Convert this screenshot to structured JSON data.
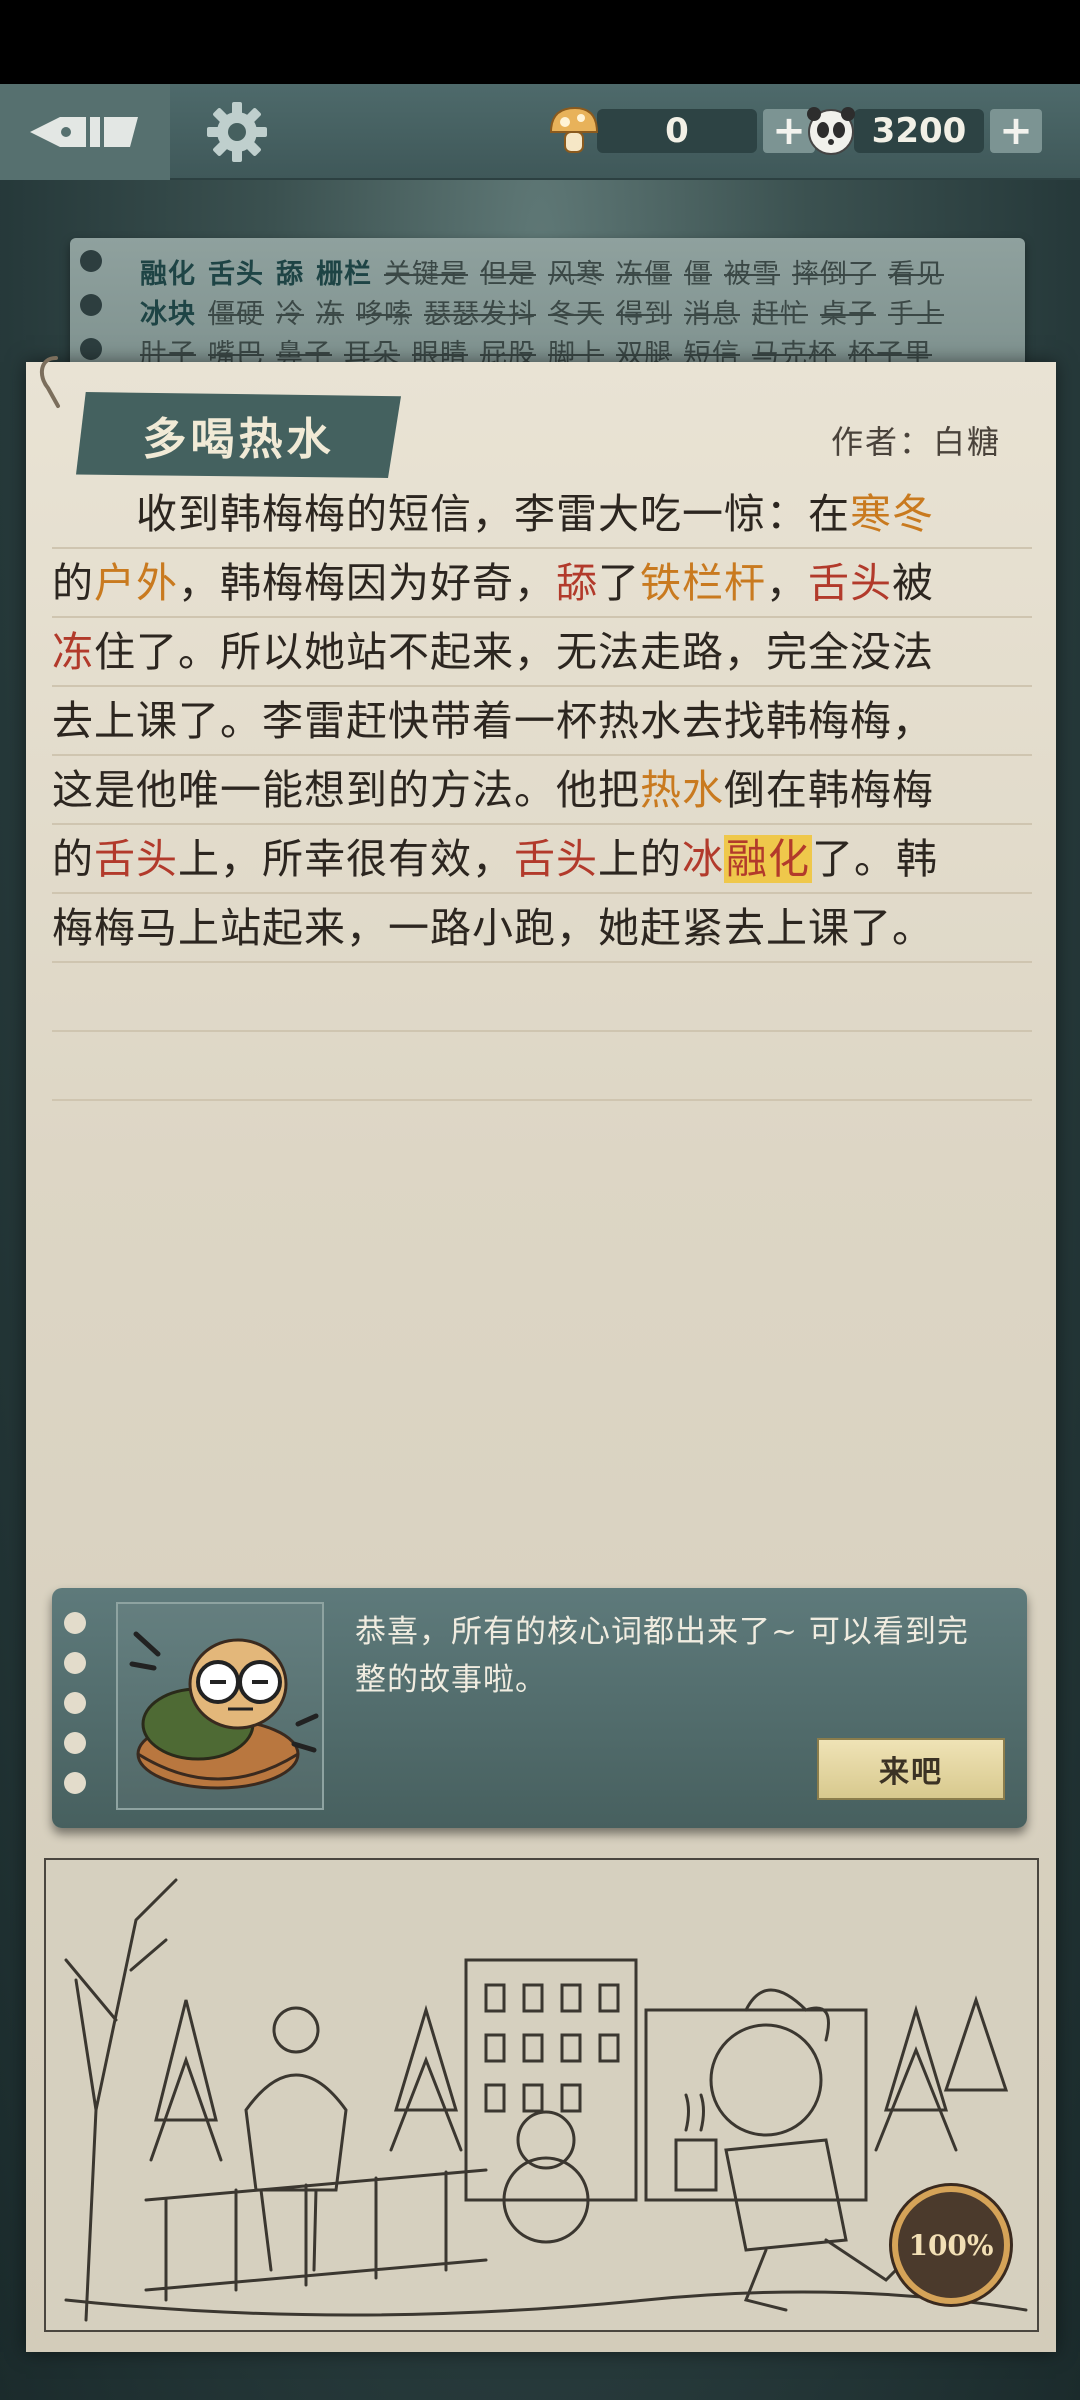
{
  "header": {
    "back_icon": "fountain-pen-back-icon",
    "settings_icon": "gear-icon",
    "currency_1": {
      "icon": "mushroom-coin-icon",
      "value": "0",
      "plus": "+"
    },
    "currency_2": {
      "icon": "panda-coin-icon",
      "value": "3200",
      "plus": "+"
    }
  },
  "word_card": {
    "rows": [
      [
        {
          "t": "融化",
          "s": false
        },
        {
          "t": "舌头",
          "s": false
        },
        {
          "t": "舔",
          "s": false
        },
        {
          "t": "栅栏",
          "s": false
        },
        {
          "t": "关键是",
          "s": true
        },
        {
          "t": "但是",
          "s": true
        },
        {
          "t": "风寒",
          "s": true
        },
        {
          "t": "冻僵",
          "s": true
        },
        {
          "t": "僵",
          "s": true
        },
        {
          "t": "被雪",
          "s": true
        },
        {
          "t": "摔倒了",
          "s": true
        },
        {
          "t": "看见",
          "s": true
        }
      ],
      [
        {
          "t": "冰块",
          "s": false
        },
        {
          "t": "僵硬",
          "s": true
        },
        {
          "t": "冷",
          "s": true
        },
        {
          "t": "冻",
          "s": true
        },
        {
          "t": "哆嗦",
          "s": true
        },
        {
          "t": "瑟瑟发抖",
          "s": true
        },
        {
          "t": "冬天",
          "s": true
        },
        {
          "t": "得到",
          "s": true
        },
        {
          "t": "消息",
          "s": true
        },
        {
          "t": "赶忙",
          "s": true
        },
        {
          "t": "桌子",
          "s": true
        },
        {
          "t": "手上",
          "s": true
        }
      ],
      [
        {
          "t": "肚子",
          "s": true
        },
        {
          "t": "嘴巴",
          "s": true
        },
        {
          "t": "鼻子",
          "s": true
        },
        {
          "t": "耳朵",
          "s": true
        },
        {
          "t": "眼睛",
          "s": true
        },
        {
          "t": "屁股",
          "s": true
        },
        {
          "t": "脚上",
          "s": true
        },
        {
          "t": "双腿",
          "s": true
        },
        {
          "t": "短信",
          "s": true
        },
        {
          "t": "马克杯",
          "s": true
        },
        {
          "t": "杯子里",
          "s": true
        }
      ]
    ]
  },
  "story": {
    "title": "多喝热水",
    "author": "作者：白糖",
    "lines": [
      [
        {
          "t": "　　收到韩梅梅的短信，李雷大吃一惊：在"
        },
        {
          "t": "寒冬",
          "c": "orange"
        }
      ],
      [
        {
          "t": "的"
        },
        {
          "t": "户外",
          "c": "orange"
        },
        {
          "t": "，韩梅梅因为好奇，"
        },
        {
          "t": "舔",
          "c": "red"
        },
        {
          "t": "了"
        },
        {
          "t": "铁栏杆",
          "c": "orange"
        },
        {
          "t": "，"
        },
        {
          "t": "舌头",
          "c": "red"
        },
        {
          "t": "被"
        }
      ],
      [
        {
          "t": "冻",
          "c": "red"
        },
        {
          "t": "住了。所以她站不起来，无法走路，完全没法"
        }
      ],
      [
        {
          "t": "去上课了。李雷赶快带着一杯热水去找韩梅梅，"
        }
      ],
      [
        {
          "t": "这是他唯一能想到的方法。他把"
        },
        {
          "t": "热水",
          "c": "orange"
        },
        {
          "t": "倒在韩梅梅"
        }
      ],
      [
        {
          "t": "的"
        },
        {
          "t": "舌头",
          "c": "red"
        },
        {
          "t": "上，所幸很有效，"
        },
        {
          "t": "舌头",
          "c": "red"
        },
        {
          "t": "上的"
        },
        {
          "t": "冰",
          "c": "red"
        },
        {
          "t": "融化",
          "c": "yellow"
        },
        {
          "t": "了。韩"
        }
      ],
      [
        {
          "t": "梅梅马上站起来，一路小跑，她赶紧去上课了。"
        }
      ]
    ],
    "empty_lines": 2
  },
  "banner": {
    "avatar_icon": "turtle-mascot-icon",
    "message": "恭喜，所有的核心词都出来了~ 可以看到完整的故事啦。",
    "button_label": "来吧"
  },
  "illustration": {
    "icon": "winter-scene-sketch-icon",
    "progress": "100%"
  }
}
